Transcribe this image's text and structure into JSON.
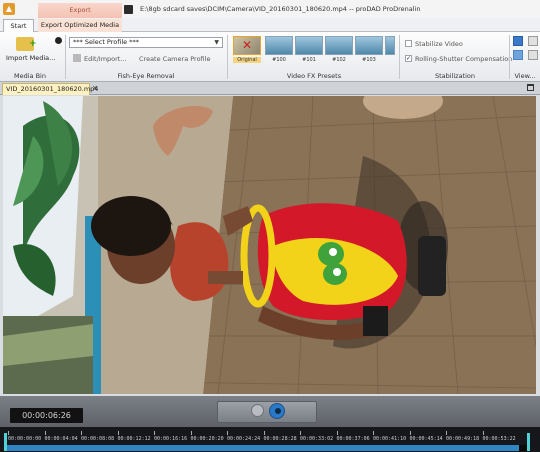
{
  "window": {
    "title": "E:\\8gb sdcard saves\\DCIM\\Camera\\VID_20160301_180620.mp4 -- proDAD ProDrenalin",
    "context_tab": "Export"
  },
  "ribbon_tabs": [
    "Start",
    "Export Optimized Media"
  ],
  "ribbon": {
    "media_bin": {
      "import_label": "Import Media...",
      "group_label": "Media Bin"
    },
    "fisheye": {
      "profile_value": "*** Select Profile ***",
      "edit_import_label": "Edit/Import...",
      "create_profile_label": "Create Camera Profile",
      "group_label": "Fish-Eye Removal"
    },
    "presets": {
      "items": [
        "Original",
        "#100",
        "#101",
        "#102",
        "#103"
      ],
      "group_label": "Video FX Presets"
    },
    "stabilization": {
      "stabilize_label": "Stabilize Video",
      "stabilize_checked": false,
      "rolling_label": "Rolling-Shutter Compensation",
      "rolling_checked": true,
      "group_label": "Stabilization"
    },
    "view": {
      "group_label": "View..."
    }
  },
  "document_tab": {
    "label": "VID_20160301_180620.mp4"
  },
  "player": {
    "timecode": "00:00:06:26",
    "progress_fraction": 0.98
  },
  "timeline": {
    "ticks": [
      "00:00:00:00",
      "00:00:04:04",
      "00:00:08:08",
      "00:00:12:12",
      "00:00:16:16",
      "00:00:20:20",
      "00:00:24:24",
      "00:00:28:28",
      "00:00:33:02",
      "00:00:37:06",
      "00:00:41:10",
      "00:00:45:14",
      "00:00:49:18",
      "00:00:53:22"
    ]
  },
  "icons": {
    "app": "prodrenalin-app-icon",
    "import": "folder-add-icon",
    "record": "record-dot-icon",
    "edit": "edit-profile-icon",
    "prev": "previous-frame-icon",
    "play": "play-icon",
    "maximize": "maximize-icon",
    "close": "close-icon"
  },
  "colors": {
    "accent": "#2a79c9",
    "timeline_marker": "#4fd1d7",
    "context_tab": "#f3c2b2",
    "doc_tab": "#fdf1c2"
  }
}
